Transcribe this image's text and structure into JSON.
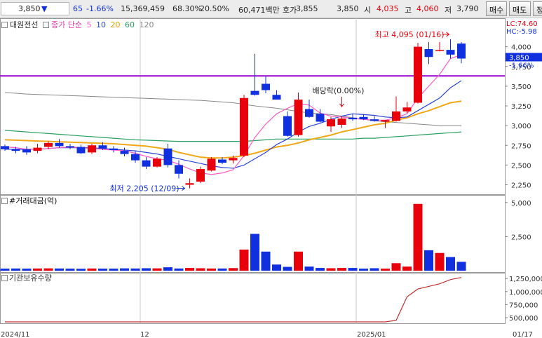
{
  "colors": {
    "up": "#e8000b",
    "down": "#1030e0",
    "ma5": "#ff5cc6",
    "ma10": "#2844d8",
    "ma20": "#f0a818",
    "ma60": "#2aa060",
    "ma120": "#888888",
    "hline": "#9a00d0",
    "inst": "#c03030"
  },
  "topbar": {
    "price": "3,850",
    "change_arrow": "▼",
    "change": "65",
    "change_pct": "-1.66%",
    "volume": "15,369,459",
    "ratio1": "68.30%",
    "ratio2": "20.50%",
    "amount": "60,471백만",
    "quote_label": "호가",
    "quote1": "3,855",
    "quote2": "3,850",
    "open_label": "시",
    "open": "4,035",
    "high_label": "고",
    "high": "4,060",
    "low_label": "저",
    "low": "3,790",
    "buy_button": "매수",
    "sell_button": "매도",
    "more_button": "정"
  },
  "legend": {
    "indicator": "대원전선",
    "ma_label": "종가 단순",
    "ma5": "5",
    "ma10": "10",
    "ma20": "20",
    "ma60": "60",
    "ma120": "120"
  },
  "price_pane": {
    "lc": "LC:74.60",
    "hc": "HC:-5.98",
    "last_price": "3,850",
    "last_change": "-1.66%",
    "annotations": {
      "high": "최고 4,095 (01/16)",
      "low": "최저 2,205 (12/09)",
      "event": "배당락(0.00%)"
    },
    "yticks": [
      "4,000",
      "3,750",
      "3,500",
      "3,250",
      "3,000",
      "2,750",
      "2,500",
      "2,250"
    ],
    "yrange": [
      2130,
      4210
    ],
    "hline_value": 3630
  },
  "volume_pane": {
    "title": "#거래대금(억)",
    "yticks": [
      "5,000",
      "2,500"
    ],
    "yrange": [
      0,
      5300
    ]
  },
  "inst_pane": {
    "title": "기관보유수량",
    "yticks": [
      "1,250,000",
      "1,000,000",
      "750,000",
      "500,000"
    ],
    "yrange": [
      380000,
      1320000
    ]
  },
  "xaxis": {
    "labels": [
      "2024/11",
      "12",
      "2025/01",
      "01/17"
    ]
  },
  "chart_data": {
    "type": "candlestick",
    "candles": [
      {
        "o": 2740,
        "h": 2760,
        "l": 2680,
        "c": 2700
      },
      {
        "o": 2700,
        "h": 2730,
        "l": 2650,
        "c": 2680
      },
      {
        "o": 2700,
        "h": 2740,
        "l": 2630,
        "c": 2660
      },
      {
        "o": 2680,
        "h": 2770,
        "l": 2650,
        "c": 2720
      },
      {
        "o": 2730,
        "h": 2800,
        "l": 2700,
        "c": 2780
      },
      {
        "o": 2780,
        "h": 2830,
        "l": 2720,
        "c": 2740
      },
      {
        "o": 2740,
        "h": 2770,
        "l": 2700,
        "c": 2730
      },
      {
        "o": 2730,
        "h": 2760,
        "l": 2640,
        "c": 2650
      },
      {
        "o": 2660,
        "h": 2770,
        "l": 2640,
        "c": 2750
      },
      {
        "o": 2750,
        "h": 2790,
        "l": 2690,
        "c": 2710
      },
      {
        "o": 2710,
        "h": 2740,
        "l": 2660,
        "c": 2690
      },
      {
        "o": 2680,
        "h": 2720,
        "l": 2610,
        "c": 2640
      },
      {
        "o": 2640,
        "h": 2680,
        "l": 2530,
        "c": 2560
      },
      {
        "o": 2560,
        "h": 2600,
        "l": 2450,
        "c": 2480
      },
      {
        "o": 2480,
        "h": 2600,
        "l": 2470,
        "c": 2580
      },
      {
        "o": 2710,
        "h": 2770,
        "l": 2470,
        "c": 2500
      },
      {
        "o": 2500,
        "h": 2560,
        "l": 2330,
        "c": 2390
      },
      {
        "o": 2250,
        "h": 2330,
        "l": 2205,
        "c": 2270
      },
      {
        "o": 2290,
        "h": 2480,
        "l": 2270,
        "c": 2450
      },
      {
        "o": 2430,
        "h": 2600,
        "l": 2420,
        "c": 2580
      },
      {
        "o": 2570,
        "h": 2600,
        "l": 2510,
        "c": 2530
      },
      {
        "o": 2560,
        "h": 2620,
        "l": 2520,
        "c": 2590
      },
      {
        "o": 2620,
        "h": 3390,
        "l": 2600,
        "c": 3350
      },
      {
        "o": 3440,
        "h": 3910,
        "l": 3380,
        "c": 3390
      },
      {
        "o": 3530,
        "h": 3630,
        "l": 3410,
        "c": 3450
      },
      {
        "o": 3390,
        "h": 3450,
        "l": 3330,
        "c": 3330
      },
      {
        "o": 3120,
        "h": 3180,
        "l": 2860,
        "c": 2870
      },
      {
        "o": 2880,
        "h": 3420,
        "l": 2860,
        "c": 3330
      },
      {
        "o": 3210,
        "h": 3330,
        "l": 3100,
        "c": 3110
      },
      {
        "o": 3150,
        "h": 3210,
        "l": 3040,
        "c": 3050
      },
      {
        "o": 2990,
        "h": 3110,
        "l": 2920,
        "c": 3080
      },
      {
        "o": 3010,
        "h": 3120,
        "l": 2970,
        "c": 3090
      },
      {
        "o": 3100,
        "h": 3150,
        "l": 3060,
        "c": 3080
      },
      {
        "o": 3110,
        "h": 3140,
        "l": 3070,
        "c": 3080
      },
      {
        "o": 3080,
        "h": 3120,
        "l": 3050,
        "c": 3060
      },
      {
        "o": 3050,
        "h": 3070,
        "l": 2970,
        "c": 3070
      },
      {
        "o": 3060,
        "h": 3370,
        "l": 3050,
        "c": 3180
      },
      {
        "o": 3180,
        "h": 3300,
        "l": 3160,
        "c": 3230
      },
      {
        "o": 3290,
        "h": 4050,
        "l": 3280,
        "c": 4000
      },
      {
        "o": 3970,
        "h": 4060,
        "l": 3780,
        "c": 3870
      },
      {
        "o": 3960,
        "h": 4060,
        "l": 3940,
        "c": 3960
      },
      {
        "o": 3960,
        "h": 4095,
        "l": 3850,
        "c": 3900
      },
      {
        "o": 4040,
        "h": 4060,
        "l": 3790,
        "c": 3850
      }
    ],
    "ma5": [
      2730,
      2720,
      2700,
      2700,
      2710,
      2720,
      2730,
      2720,
      2710,
      2700,
      2690,
      2680,
      2650,
      2610,
      2580,
      2560,
      2510,
      2450,
      2400,
      2380,
      2400,
      2440,
      2620,
      2850,
      3020,
      3150,
      3220,
      3280,
      3260,
      3160,
      3120,
      3110,
      3090,
      3080,
      3070,
      3070,
      3100,
      3150,
      3350,
      3500,
      3650,
      3850,
      3900
    ],
    "ma10": [
      2700,
      2700,
      2700,
      2700,
      2710,
      2720,
      2720,
      2720,
      2720,
      2710,
      2700,
      2690,
      2680,
      2660,
      2640,
      2610,
      2580,
      2550,
      2520,
      2490,
      2470,
      2460,
      2500,
      2580,
      2660,
      2760,
      2830,
      2920,
      2990,
      3030,
      3080,
      3120,
      3150,
      3140,
      3130,
      3110,
      3100,
      3110,
      3190,
      3270,
      3350,
      3480,
      3570
    ],
    "ma20": [
      2820,
      2815,
      2810,
      2805,
      2800,
      2795,
      2790,
      2785,
      2780,
      2775,
      2770,
      2760,
      2750,
      2740,
      2720,
      2700,
      2660,
      2630,
      2600,
      2590,
      2590,
      2600,
      2620,
      2650,
      2690,
      2730,
      2750,
      2780,
      2820,
      2850,
      2880,
      2920,
      2950,
      2980,
      3010,
      3030,
      3070,
      3100,
      3150,
      3190,
      3240,
      3290,
      3310
    ],
    "ma60": [
      2940,
      2930,
      2920,
      2910,
      2900,
      2890,
      2880,
      2870,
      2860,
      2850,
      2840,
      2830,
      2820,
      2815,
      2810,
      2805,
      2800,
      2800,
      2800,
      2800,
      2800,
      2800,
      2800,
      2810,
      2820,
      2830,
      2830,
      2830,
      2830,
      2830,
      2830,
      2830,
      2830,
      2840,
      2840,
      2850,
      2860,
      2870,
      2880,
      2890,
      2900,
      2910,
      2920
    ],
    "ma120": [
      3420,
      3410,
      3400,
      3395,
      3390,
      3385,
      3380,
      3375,
      3370,
      3365,
      3360,
      3355,
      3350,
      3345,
      3340,
      3335,
      3330,
      3325,
      3320,
      3310,
      3300,
      3290,
      3270,
      3250,
      3235,
      3220,
      3200,
      3180,
      3160,
      3150,
      3140,
      3120,
      3100,
      3080,
      3060,
      3050,
      3040,
      3030,
      3020,
      3010,
      3000,
      3000,
      3000
    ],
    "trade_amount": [
      150,
      160,
      150,
      160,
      170,
      160,
      150,
      140,
      160,
      150,
      150,
      170,
      160,
      180,
      170,
      250,
      160,
      200,
      180,
      160,
      160,
      190,
      1550,
      2700,
      1400,
      450,
      280,
      1400,
      300,
      200,
      180,
      200,
      200,
      150,
      180,
      150,
      550,
      300,
      4900,
      1500,
      1300,
      1000,
      650
    ],
    "inst_holding": [
      420000,
      420000,
      420000,
      420000,
      420000,
      420000,
      420000,
      420000,
      420000,
      420000,
      420000,
      420000,
      420000,
      420000,
      420000,
      420000,
      420000,
      420000,
      420000,
      420000,
      420000,
      420000,
      420000,
      420000,
      420000,
      420000,
      420000,
      420000,
      420000,
      420000,
      420000,
      420000,
      420000,
      420000,
      420000,
      420000,
      450000,
      900000,
      1050000,
      1100000,
      1150000,
      1230000,
      1270000
    ]
  }
}
